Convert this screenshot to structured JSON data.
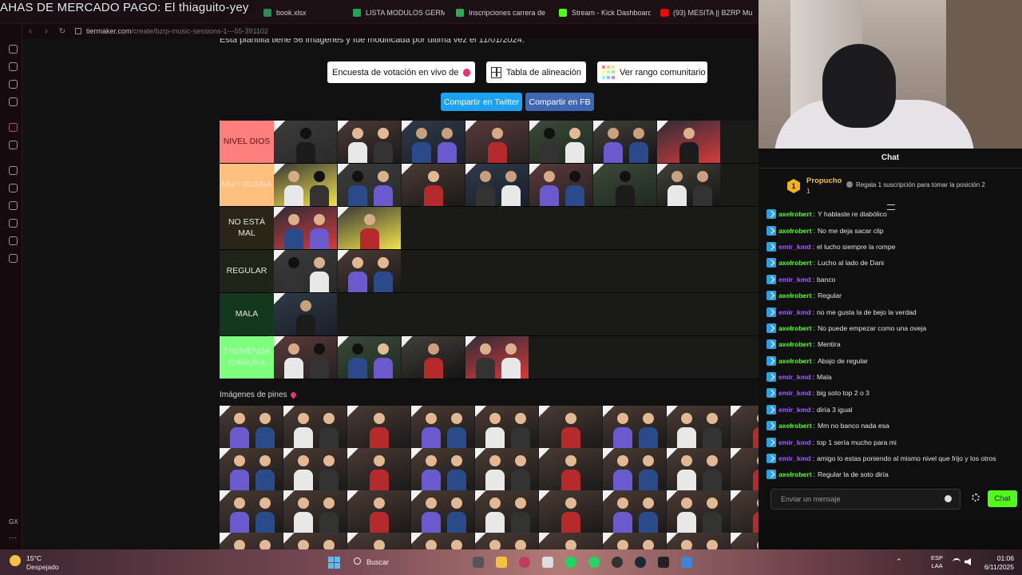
{
  "overlay_title": "AHAS DE MERCADO PAGO: El thiaguito-yey",
  "browser": {
    "tabs": [
      {
        "label": "book.xlsx",
        "color": "#2e8b57"
      },
      {
        "label": "LISTA MODULOS GERMA",
        "color": "#23a559"
      },
      {
        "label": "Inscripciones carrera de",
        "color": "#35a853"
      },
      {
        "label": "Stream - Kick Dashboard",
        "color": "#53fc18"
      },
      {
        "label": "(93) MESITA || BZRP Mu",
        "color": "#ff0000"
      }
    ],
    "url_host": "tiermaker.com",
    "url_path": "/create/bzrp-music-sessions-1---55-391102"
  },
  "page": {
    "description": "Esta plantilla tiene 56 imágenes y fue modificada por última vez el 11/01/2024.",
    "buttons": {
      "live_poll": "Encuesta de votación en vivo de",
      "alignment": "Tabla de alineación",
      "community": "Ver rango comunitario",
      "twitter": "Compartir en Twitter",
      "facebook": "Compartir en FB"
    },
    "colors": {
      "twitter": "#1da1f2",
      "facebook": "#4267b2",
      "record": "#e8336d"
    },
    "tiers": [
      {
        "label": "NIVEL DIOS",
        "color": "#ff7f7f",
        "text_color": "#5c1212",
        "count": 7
      },
      {
        "label": "MUY BUENA",
        "color": "#ffbf7f",
        "text_color": "#f5e3c9",
        "count": 7
      },
      {
        "label": "NO ESTÁ MAL",
        "color": "#2a2516",
        "text_color": "#e4e4e4",
        "count": 2
      },
      {
        "label": "REGULAR",
        "color": "#1f2318",
        "text_color": "#e4e4e4",
        "count": 2
      },
      {
        "label": "MALA",
        "color": "#13381e",
        "text_color": "#e4e4e4",
        "count": 1
      },
      {
        "label": "TREMENDA MAMUKA",
        "color": "#7fff7f",
        "text_color": "#c9f7c9",
        "count": 4
      }
    ],
    "pins_title": "Imágenes de pines",
    "pins_count": 36
  },
  "chat": {
    "title": "Chat",
    "gift_user": "Propucho",
    "gift_rank": "1",
    "gift_count": "1",
    "gift_promo": "Regala 1 suscripción para tomar la posición 2",
    "messages": [
      {
        "user": "axelrobert",
        "color": "#53fc18",
        "text": "Y hablaste re diabólico"
      },
      {
        "user": "axelrobert",
        "color": "#53fc18",
        "text": "No me deja sacar clip"
      },
      {
        "user": "emir_kmd",
        "color": "#a45cff",
        "text": "el lucho siempre la rompe"
      },
      {
        "user": "axelrobert",
        "color": "#53fc18",
        "text": "Lucho al lado de Dani"
      },
      {
        "user": "emir_kmd",
        "color": "#a45cff",
        "text": "banco"
      },
      {
        "user": "axelrobert",
        "color": "#53fc18",
        "text": "Regular"
      },
      {
        "user": "emir_kmd",
        "color": "#a45cff",
        "text": "no me gusta la de bejo la verdad"
      },
      {
        "user": "axelrobert",
        "color": "#53fc18",
        "text": "No puede empezar como una oveja"
      },
      {
        "user": "axelrobert",
        "color": "#53fc18",
        "text": "Mentira"
      },
      {
        "user": "axelrobert",
        "color": "#53fc18",
        "text": "Abajo de regular"
      },
      {
        "user": "emir_kmd",
        "color": "#a45cff",
        "text": "Mala"
      },
      {
        "user": "emir_kmd",
        "color": "#a45cff",
        "text": "big soto top 2 o 3"
      },
      {
        "user": "emir_kmd",
        "color": "#a45cff",
        "text": "diría 3 igual"
      },
      {
        "user": "axelrobert",
        "color": "#53fc18",
        "text": "Mm no banco nada esa"
      },
      {
        "user": "emir_kmd",
        "color": "#a45cff",
        "text": "top 1 sería mucho para mi"
      },
      {
        "user": "emir_kmd",
        "color": "#a45cff",
        "text": "amigo lo estas poniendo al mismo nivel que frijo y los otros"
      },
      {
        "user": "axelrobert",
        "color": "#53fc18",
        "text": "Regular la de soto diría"
      }
    ],
    "input_placeholder": "Enviar un mensaje",
    "send_label": "Chat",
    "accent": "#53fc18"
  },
  "taskbar": {
    "temperature": "15°C",
    "weather": "Despejado",
    "search": "Buscar",
    "lang_1": "ESP",
    "lang_2": "LAA",
    "time": "01:06",
    "date": "6/11/2025"
  }
}
